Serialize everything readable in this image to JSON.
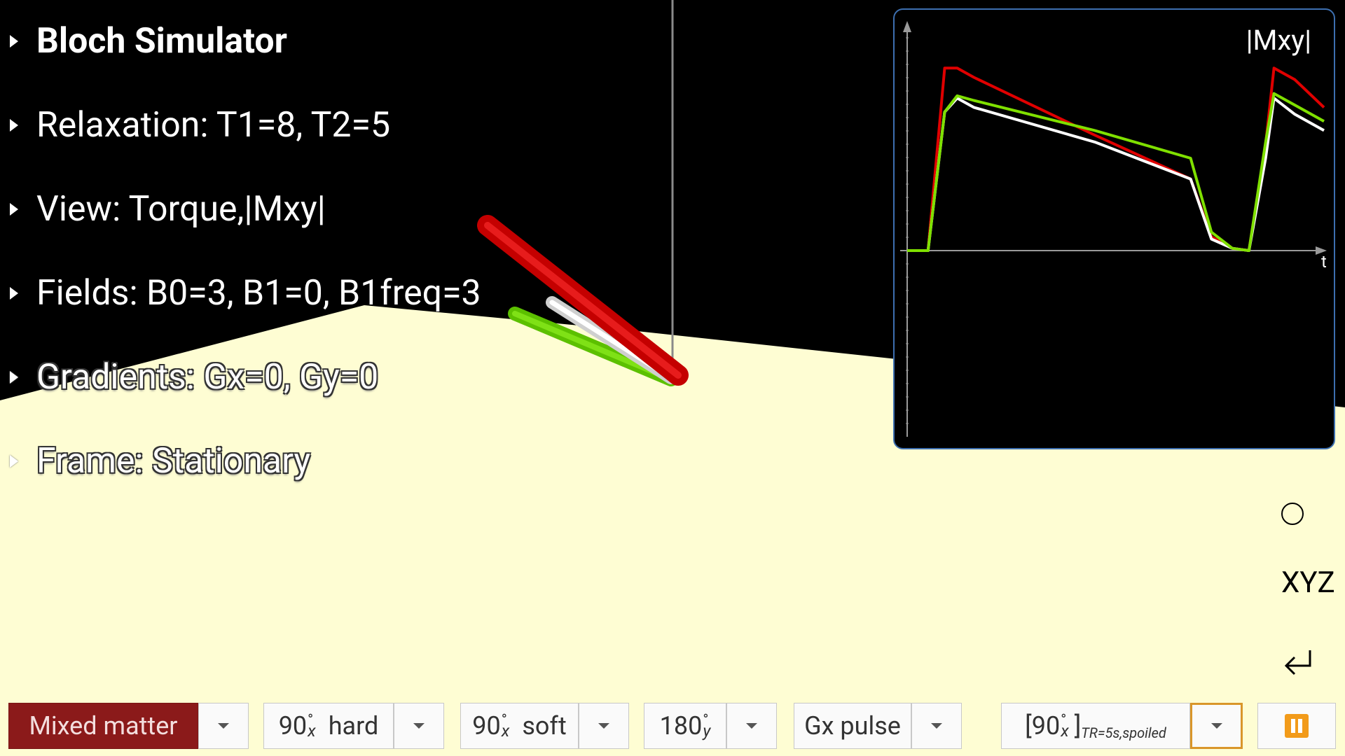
{
  "app": {
    "title": "Bloch Simulator"
  },
  "menu": [
    {
      "label": "Bloch Simulator",
      "style": "bold"
    },
    {
      "label": "Relaxation: T1=8, T2=5",
      "style": "normal"
    },
    {
      "label": "View: Torque,|Mxy|",
      "style": "normal"
    },
    {
      "label": "Fields: B0=3, B1=0, B1freq=3",
      "style": "normal"
    },
    {
      "label": "Gradients: Gx=0, Gy=0",
      "style": "outlined"
    },
    {
      "label": "Frame: Stationary",
      "style": "outlined"
    }
  ],
  "plot": {
    "title": "|Mxy|",
    "x_axis_label": "t",
    "colors": {
      "red": "#e00000",
      "white": "#ffffff",
      "green": "#7fe000",
      "axis": "#9a9a9a"
    }
  },
  "chart_data": {
    "type": "line",
    "title": "|Mxy|",
    "xlabel": "t",
    "ylabel": "",
    "grid": false,
    "x": [
      0,
      0.05,
      0.09,
      0.12,
      0.16,
      0.45,
      0.68,
      0.73,
      0.78,
      0.82,
      0.86,
      0.88,
      0.93,
      1.0
    ],
    "series": [
      {
        "color": "#e00000",
        "values": [
          0,
          0,
          0.79,
          0.79,
          0.75,
          0.5,
          0.31,
          0.06,
          0.01,
          0,
          0.46,
          0.79,
          0.74,
          0.62
        ]
      },
      {
        "color": "#ffffff",
        "values": [
          0,
          0,
          0.6,
          0.66,
          0.62,
          0.47,
          0.31,
          0.05,
          0.01,
          0,
          0.4,
          0.66,
          0.59,
          0.52
        ]
      },
      {
        "color": "#7fe000",
        "values": [
          0,
          0,
          0.6,
          0.67,
          0.65,
          0.52,
          0.4,
          0.08,
          0.01,
          0,
          0.47,
          0.68,
          0.63,
          0.56
        ]
      }
    ]
  },
  "side_controls": {
    "circle_icon": "circle-icon",
    "xyz_label": "XYZ",
    "return_icon": "return-icon"
  },
  "bottom_bar": {
    "matter": {
      "label": "Mixed matter",
      "active": true
    },
    "hard_pulse": {
      "angle": "90",
      "axis": "x",
      "label": "hard"
    },
    "soft_pulse": {
      "angle": "90",
      "axis": "x",
      "label": "soft"
    },
    "inversion": {
      "angle": "180",
      "axis": "y"
    },
    "gradient": {
      "label": "Gx pulse"
    },
    "sequence": {
      "bracket_open": "[90",
      "axis": "x",
      "bracket_close": "]",
      "subscript": "TR=5s,spoiled"
    },
    "pause_icon": "pause-icon",
    "pause_color": "#f29b1a"
  }
}
